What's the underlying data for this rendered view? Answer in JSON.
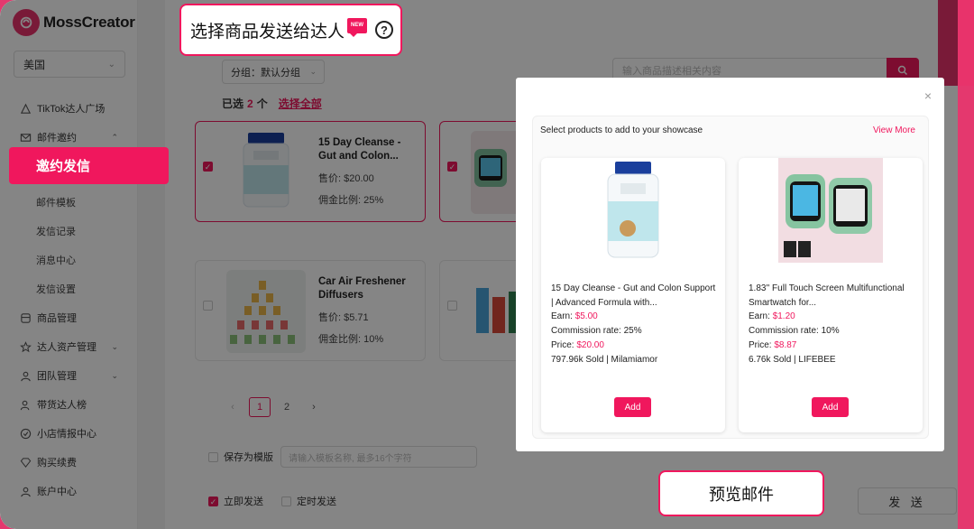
{
  "brand": {
    "name": "MossCreator",
    "accent": "#f0175d"
  },
  "sidebar": {
    "country": "美国",
    "items": [
      {
        "label": "TikTok达人广场",
        "icon": "plaza-icon"
      },
      {
        "label": "邮件邀约",
        "icon": "mail-icon"
      },
      {
        "label": "邀约发信"
      },
      {
        "label": "邮件模板"
      },
      {
        "label": "发信记录"
      },
      {
        "label": "消息中心"
      },
      {
        "label": "发信设置"
      },
      {
        "label": "商品管理",
        "icon": "product-icon"
      },
      {
        "label": "达人资产管理",
        "icon": "star-icon"
      },
      {
        "label": "团队管理",
        "icon": "team-icon"
      },
      {
        "label": "带货达人榜",
        "icon": "rank-icon"
      },
      {
        "label": "小店情报中心",
        "icon": "shop-icon"
      },
      {
        "label": "购买续费",
        "icon": "diamond-icon"
      },
      {
        "label": "账户中心",
        "icon": "user-icon"
      }
    ]
  },
  "callouts": {
    "title": "选择商品发送给达人",
    "new_badge": "NEW",
    "help": "?",
    "preview": "预览邮件"
  },
  "main": {
    "group_select": "分组：默认分组",
    "search_placeholder": "输入商品描述相关内容",
    "selected_prefix": "已选",
    "selected_count": "2",
    "selected_suffix": "个",
    "select_all": "选择全部",
    "products": [
      {
        "title": "15 Day Cleanse - Gut and Colon...",
        "price": "售价: $20.00",
        "commission": "佣金比例: 25%",
        "selected": true
      },
      {
        "title": "",
        "price": "",
        "commission": "",
        "selected": true
      },
      {
        "title": "Car Air Freshener Diffusers",
        "price": "售价: $5.71",
        "commission": "佣金比例: 10%",
        "selected": false
      },
      {
        "title": "",
        "price": "",
        "commission": "",
        "selected": false
      }
    ],
    "pager": {
      "prev": "‹",
      "pages": [
        "1",
        "2"
      ],
      "next": "›",
      "current": "1"
    },
    "save_template_label": "保存为模版",
    "template_placeholder": "请输入模板名称, 最多16个字符",
    "send_now": "立即发送",
    "send_scheduled": "定时发送",
    "send_button": "发 送"
  },
  "modal": {
    "close": "×",
    "header": "Select products to add to your showcase",
    "view_more": "View More",
    "products": [
      {
        "title": "15 Day Cleanse - Gut and Colon Support | Advanced Formula with...",
        "earn_label": "Earn:",
        "earn": "$5.00",
        "commission": "Commission rate: 25%",
        "price_label": "Price:",
        "price": "$20.00",
        "sold": "797.96k Sold | Milamiamor",
        "add": "Add"
      },
      {
        "title": "1.83'' Full Touch Screen Multifunctional Smartwatch for...",
        "earn_label": "Earn:",
        "earn": "$1.20",
        "commission": "Commission rate: 10%",
        "price_label": "Price:",
        "price": "$8.87",
        "sold": "6.76k Sold | LIFEBEE",
        "add": "Add"
      }
    ]
  }
}
